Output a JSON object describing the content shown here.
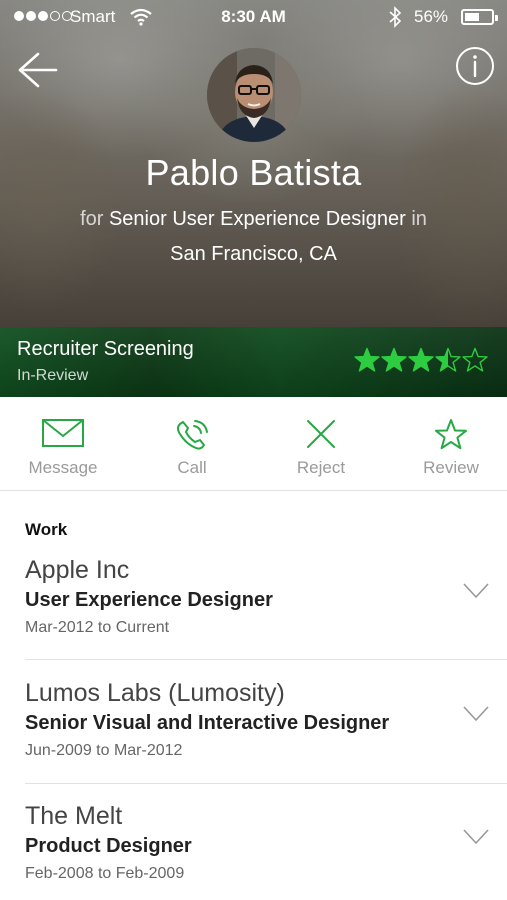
{
  "status_bar": {
    "carrier": "Smart",
    "time": "8:30 AM",
    "battery_percent": "56%",
    "battery_level": 0.56
  },
  "header": {
    "name": "Pablo Batista",
    "role_prefix": "for",
    "role": "Senior User Experience Designer",
    "role_suffix": "in",
    "location": "San Francisco, CA",
    "back_icon": "arrow-left-icon",
    "info_icon": "info-icon"
  },
  "stage": {
    "title": "Recruiter Screening",
    "status": "In-Review",
    "rating": 3.5,
    "rating_max": 5,
    "accent_color": "#2ecc40"
  },
  "actions": [
    {
      "label": "Message",
      "icon": "envelope-icon"
    },
    {
      "label": "Call",
      "icon": "phone-icon"
    },
    {
      "label": "Reject",
      "icon": "x-icon"
    },
    {
      "label": "Review",
      "icon": "star-outline-icon"
    }
  ],
  "work": {
    "section_title": "Work",
    "jobs": [
      {
        "company": "Apple Inc",
        "title": "User Experience Designer",
        "dates": "Mar-2012 to Current"
      },
      {
        "company": "Lumos Labs (Lumosity)",
        "title": "Senior Visual and Interactive Designer",
        "dates": "Jun-2009 to Mar-2012"
      },
      {
        "company": "The Melt",
        "title": "Product Designer",
        "dates": "Feb-2008 to Feb-2009"
      }
    ]
  },
  "colors": {
    "icon_green": "#27a844",
    "stage_green": "#0e4a1d",
    "label_gray": "#9a9a9a"
  }
}
